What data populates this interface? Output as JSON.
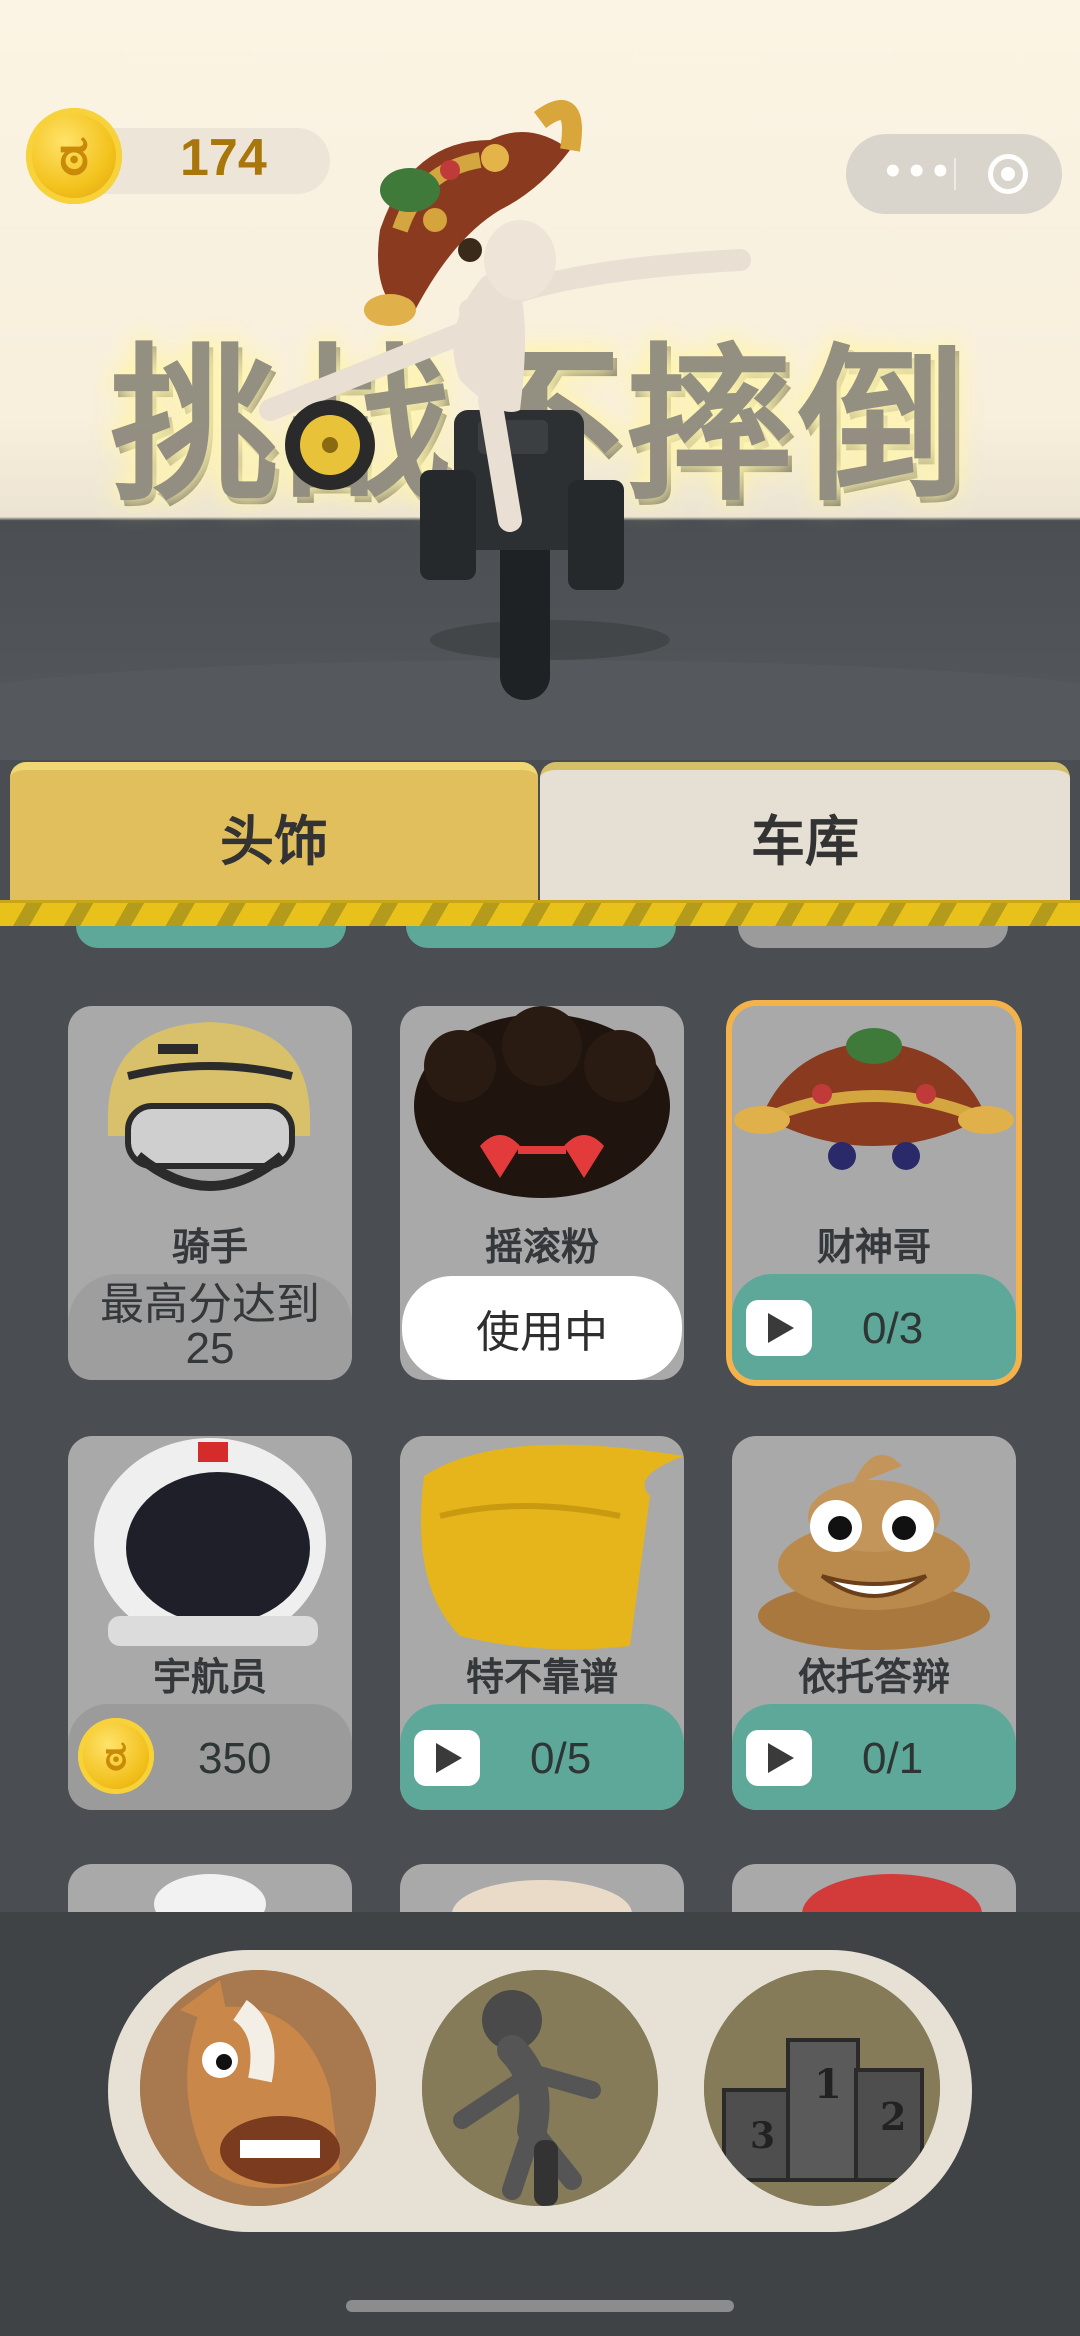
{
  "header": {
    "coin_icon": "coin-icon",
    "coin_symbol": "ಠ",
    "coin_count": "174",
    "more_dots": "•••",
    "game_title": "挑战不摔倒"
  },
  "tabs": [
    {
      "label": "头饰",
      "active": true
    },
    {
      "label": "车库",
      "active": false
    }
  ],
  "items": [
    {
      "name": "骑手",
      "status_type": "locked",
      "status_line1": "最高分达到",
      "status_line2": "25",
      "icon": "helmet-icon"
    },
    {
      "name": "摇滚粉",
      "status_type": "in-use",
      "status": "使用中",
      "icon": "afro-sunglasses-icon"
    },
    {
      "name": "财神哥",
      "status_type": "video",
      "progress": "0/3",
      "icon": "fortune-crown-icon",
      "selected": true
    },
    {
      "name": "宇航员",
      "status_type": "coin",
      "price": "350",
      "icon": "astronaut-helmet-icon"
    },
    {
      "name": "特不靠谱",
      "status_type": "video",
      "progress": "0/5",
      "icon": "golden-hair-icon"
    },
    {
      "name": "依托答辩",
      "status_type": "video",
      "progress": "0/1",
      "icon": "poop-icon"
    }
  ],
  "bottom_nav": [
    {
      "name": "horse-mask-button",
      "icon": "horse-head-icon"
    },
    {
      "name": "rider-button",
      "icon": "cyclist-icon"
    },
    {
      "name": "leaderboard-button",
      "icon": "podium-icon"
    }
  ],
  "colors": {
    "accent_gold": "#e1bf5c",
    "teal": "#5ea89a",
    "selected_border": "#f4b24a",
    "card_bg": "#a9a9a9"
  }
}
